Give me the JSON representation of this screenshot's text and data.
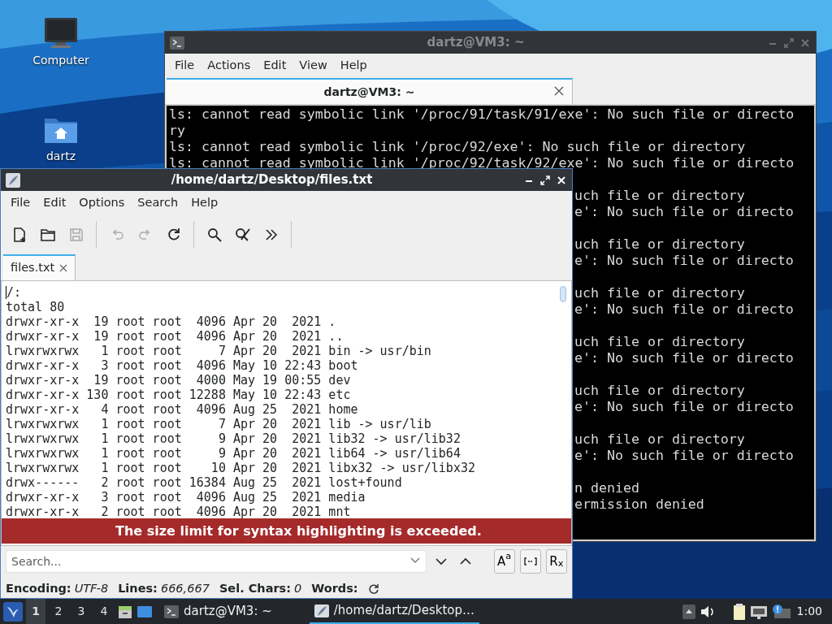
{
  "desktop_icons": [
    {
      "label": "Computer",
      "kind": "computer"
    },
    {
      "label": "dartz",
      "kind": "home-folder"
    }
  ],
  "terminal_window": {
    "title": "dartz@VM3: ~",
    "active": false,
    "menu": [
      "File",
      "Actions",
      "Edit",
      "View",
      "Help"
    ],
    "tabs": [
      {
        "label": "dartz@VM3: ~",
        "selected": true
      }
    ],
    "lines": [
      {
        "kind": "full",
        "text": "ls: cannot read symbolic link '/proc/91/task/91/exe': No such file or directo"
      },
      {
        "kind": "full",
        "text": "ry"
      },
      {
        "kind": "full",
        "text": "ls: cannot read symbolic link '/proc/92/exe': No such file or directory"
      },
      {
        "kind": "full",
        "text": "ls: cannot read symbolic link '/proc/92/task/92/exe': No such file or directo"
      },
      {
        "kind": "blank"
      },
      {
        "kind": "clipped",
        "text": "uch file or directory"
      },
      {
        "kind": "clipped",
        "text": "e': No such file or directo"
      },
      {
        "kind": "blank"
      },
      {
        "kind": "clipped",
        "text": "uch file or directory"
      },
      {
        "kind": "clipped",
        "text": "e': No such file or directo"
      },
      {
        "kind": "blank"
      },
      {
        "kind": "clipped",
        "text": "uch file or directory"
      },
      {
        "kind": "clipped",
        "text": "e': No such file or directo"
      },
      {
        "kind": "blank"
      },
      {
        "kind": "clipped",
        "text": "uch file or directory"
      },
      {
        "kind": "clipped",
        "text": "e': No such file or directo"
      },
      {
        "kind": "blank"
      },
      {
        "kind": "clipped",
        "text": "uch file or directory"
      },
      {
        "kind": "clipped",
        "text": "e': No such file or directo"
      },
      {
        "kind": "blank"
      },
      {
        "kind": "clipped",
        "text": "uch file or directory"
      },
      {
        "kind": "clipped",
        "text": "e': No such file or directo"
      },
      {
        "kind": "blank"
      },
      {
        "kind": "clipped",
        "text": "n denied"
      },
      {
        "kind": "clipped",
        "text": "ermission denied"
      }
    ]
  },
  "editor_window": {
    "title": "/home/dartz/Desktop/files.txt",
    "active": true,
    "menu": [
      "File",
      "Edit",
      "Options",
      "Search",
      "Help"
    ],
    "toolbar": [
      {
        "kind": "new",
        "disabled": false
      },
      {
        "kind": "open",
        "disabled": false
      },
      {
        "kind": "save",
        "disabled": true
      },
      {
        "kind": "separator"
      },
      {
        "kind": "undo",
        "disabled": true
      },
      {
        "kind": "redo",
        "disabled": true
      },
      {
        "kind": "reload",
        "disabled": false
      },
      {
        "kind": "separator"
      },
      {
        "kind": "find",
        "disabled": false
      },
      {
        "kind": "replace",
        "disabled": false
      },
      {
        "kind": "more",
        "disabled": false
      },
      {
        "kind": "separator"
      }
    ],
    "tabs": [
      {
        "label": "files.txt",
        "selected": true
      }
    ],
    "lines": [
      "/:",
      "total 80",
      "drwxr-xr-x  19 root root  4096 Apr 20  2021 .",
      "drwxr-xr-x  19 root root  4096 Apr 20  2021 ..",
      "lrwxrwxrwx   1 root root     7 Apr 20  2021 bin -> usr/bin",
      "drwxr-xr-x   3 root root  4096 May 10 22:43 boot",
      "drwxr-xr-x  19 root root  4000 May 19 00:55 dev",
      "drwxr-xr-x 130 root root 12288 May 10 22:43 etc",
      "drwxr-xr-x   4 root root  4096 Aug 25  2021 home",
      "lrwxrwxrwx   1 root root     7 Apr 20  2021 lib -> usr/lib",
      "lrwxrwxrwx   1 root root     9 Apr 20  2021 lib32 -> usr/lib32",
      "lrwxrwxrwx   1 root root     9 Apr 20  2021 lib64 -> usr/lib64",
      "lrwxrwxrwx   1 root root    10 Apr 20  2021 libx32 -> usr/libx32",
      "drwx------   2 root root 16384 Aug 25  2021 lost+found",
      "drwxr-xr-x   3 root root  4096 Aug 25  2021 media",
      "drwxr-xr-x   2 root root  4096 Apr 20  2021 mnt"
    ],
    "banner": "The size limit for syntax highlighting is exceeded.",
    "search": {
      "placeholder": "Search..."
    },
    "search_options": [
      {
        "kind": "text",
        "label": "A$^{a}$"
      },
      {
        "kind": "whole-word"
      },
      {
        "kind": "text",
        "label": "R$_{x}$"
      }
    ],
    "status": [
      {
        "label": "Encoding:",
        "value": "UTF-8"
      },
      {
        "label": "Lines:",
        "value": "666,667"
      },
      {
        "label": "Sel. Chars:",
        "value": "0"
      },
      {
        "label": "Words:"
      }
    ]
  },
  "taskbar": {
    "workspaces": [
      {
        "label": "1",
        "selected": true
      },
      {
        "label": "2",
        "selected": false
      },
      {
        "label": "3",
        "selected": false
      },
      {
        "label": "4",
        "selected": false
      }
    ],
    "tasks": [
      {
        "kind": "terminal",
        "label": "dartz@VM3: ~",
        "selected": false
      },
      {
        "kind": "editor",
        "label": "/home/dartz/Desktop…",
        "selected": true
      }
    ],
    "clock": "1:00"
  }
}
